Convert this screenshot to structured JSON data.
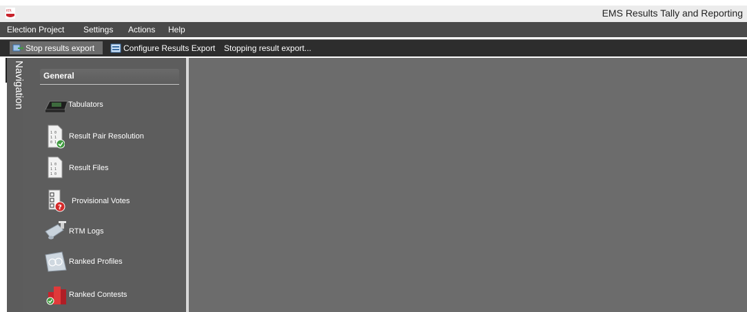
{
  "window": {
    "title": "EMS Results Tally and Reporting",
    "app_icon": "rtm-logo-icon"
  },
  "menu": {
    "items": [
      "Election Project",
      "Settings",
      "Actions",
      "Help"
    ]
  },
  "toolbar": {
    "stop_export_label": "Stop results export",
    "configure_export_label": "Configure Results Export",
    "status_text": "Stopping result export..."
  },
  "navigation": {
    "tab_label": "Navigation",
    "group_title": "General",
    "items": [
      {
        "label": "Tabulators",
        "icon": "tabulator-icon"
      },
      {
        "label": "Result Pair Resolution",
        "icon": "result-pair-resolution-icon"
      },
      {
        "label": "Result Files",
        "icon": "result-files-icon"
      },
      {
        "label": "Provisional Votes",
        "icon": "provisional-votes-icon"
      },
      {
        "label": "RTM Logs",
        "icon": "rtm-logs-icon"
      },
      {
        "label": "Ranked Profiles",
        "icon": "ranked-profiles-icon"
      },
      {
        "label": "Ranked Contests",
        "icon": "ranked-contests-icon"
      }
    ]
  },
  "colors": {
    "menubar": "#4a4a4a",
    "toolbar": "#2d2d2d",
    "nav_panel": "#5d5d5d",
    "content": "#6c6c6c",
    "accent_red": "#c8232c"
  }
}
